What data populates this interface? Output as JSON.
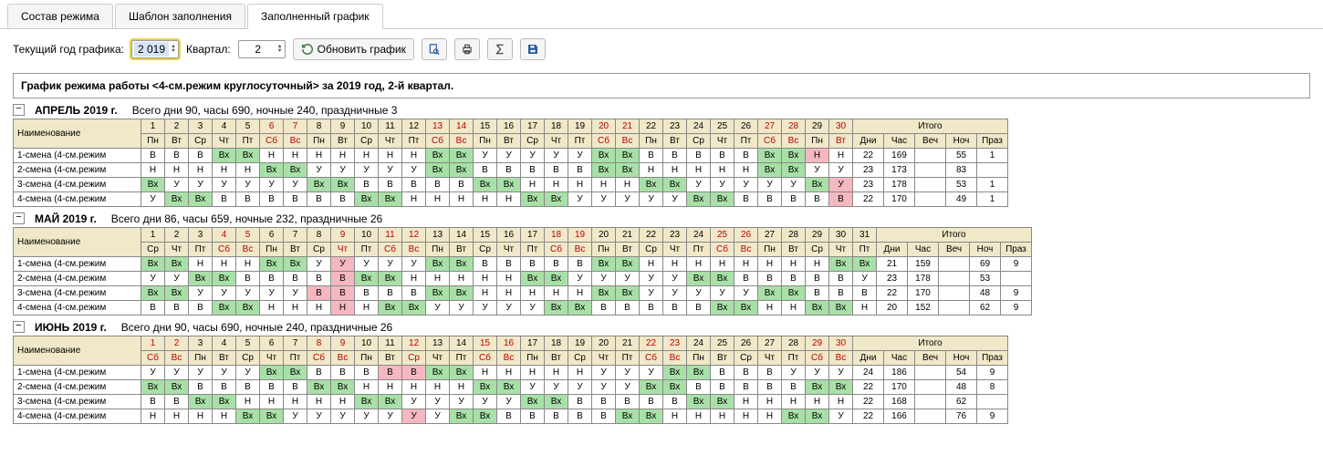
{
  "tabs": [
    "Состав режима",
    "Шаблон заполнения",
    "Заполненный график"
  ],
  "activeTab": 2,
  "toolbar": {
    "yearLabel": "Текущий год графика:",
    "yearValue": "2 019",
    "quarterLabel": "Квартал:",
    "quarterValue": "2",
    "refresh": "Обновить график"
  },
  "title": "График режима работы <4-см.режим круглосуточный> за 2019 год, 2-й квартал.",
  "rowHeader": "Наименование",
  "totalsHeader": "Итого",
  "totalsCols": [
    "Дни",
    "Час",
    "Веч",
    "Ноч",
    "Праз"
  ],
  "shifts": [
    "1-смена (4-см.режим",
    "2-смена (4-см.режим",
    "3-смена (4-см.режим",
    "4-смена (4-см.режим"
  ],
  "months": [
    {
      "name": "АПРЕЛЬ 2019 г.",
      "summary": "Всего дни 90, часы 690, ночные 240, праздничные 3",
      "nums": [
        "1",
        "2",
        "3",
        "4",
        "5",
        "6",
        "7",
        "8",
        "9",
        "10",
        "11",
        "12",
        "13",
        "14",
        "15",
        "16",
        "17",
        "18",
        "19",
        "20",
        "21",
        "22",
        "23",
        "24",
        "25",
        "26",
        "27",
        "28",
        "29",
        "30"
      ],
      "numsRed": [
        0,
        0,
        0,
        0,
        0,
        1,
        1,
        0,
        0,
        0,
        0,
        0,
        1,
        1,
        0,
        0,
        0,
        0,
        0,
        1,
        1,
        0,
        0,
        0,
        0,
        0,
        1,
        1,
        0,
        1
      ],
      "dows": [
        "Пн",
        "Вт",
        "Ср",
        "Чт",
        "Пт",
        "Сб",
        "Вс",
        "Пн",
        "Вт",
        "Ср",
        "Чт",
        "Пт",
        "Сб",
        "Вс",
        "Пн",
        "Вт",
        "Ср",
        "Чт",
        "Пт",
        "Сб",
        "Вс",
        "Пн",
        "Вт",
        "Ср",
        "Чт",
        "Пт",
        "Сб",
        "Вс",
        "Пн",
        "Вт"
      ],
      "rows": [
        {
          "cells": [
            "В",
            "В",
            "В",
            "Вх",
            "Вх",
            "Н",
            "Н",
            "Н",
            "Н",
            "Н",
            "Н",
            "Н",
            "Вх",
            "Вх",
            "У",
            "У",
            "У",
            "У",
            "У",
            "Вх",
            "Вх",
            "В",
            "В",
            "В",
            "В",
            "В",
            "Вх",
            "Вх",
            "Н",
            "Н"
          ],
          "colors": [
            "",
            "",
            "",
            "g",
            "g",
            "",
            "",
            "",
            "",
            "",
            "",
            "",
            "g",
            "g",
            "",
            "",
            "",
            "",
            "",
            "g",
            "g",
            "",
            "",
            "",
            "",
            "",
            "g",
            "g",
            "p",
            ""
          ],
          "totals": [
            "22",
            "169",
            "",
            "55",
            "1"
          ]
        },
        {
          "cells": [
            "Н",
            "Н",
            "Н",
            "Н",
            "Н",
            "Вх",
            "Вх",
            "У",
            "У",
            "У",
            "У",
            "У",
            "Вх",
            "Вх",
            "В",
            "В",
            "В",
            "В",
            "В",
            "Вх",
            "Вх",
            "Н",
            "Н",
            "Н",
            "Н",
            "Н",
            "Вх",
            "Вх",
            "У",
            "У"
          ],
          "colors": [
            "",
            "",
            "",
            "",
            "",
            "g",
            "g",
            "",
            "",
            "",
            "",
            "",
            "g",
            "g",
            "",
            "",
            "",
            "",
            "",
            "g",
            "g",
            "",
            "",
            "",
            "",
            "",
            "g",
            "g",
            "",
            ""
          ],
          "totals": [
            "23",
            "173",
            "",
            "83",
            ""
          ]
        },
        {
          "cells": [
            "Вх",
            "У",
            "У",
            "У",
            "У",
            "У",
            "У",
            "Вх",
            "Вх",
            "В",
            "В",
            "В",
            "В",
            "В",
            "Вх",
            "Вх",
            "Н",
            "Н",
            "Н",
            "Н",
            "Н",
            "Вх",
            "Вх",
            "У",
            "У",
            "У",
            "У",
            "У",
            "Вх",
            "У"
          ],
          "colors": [
            "g",
            "",
            "",
            "",
            "",
            "",
            "",
            "g",
            "g",
            "",
            "",
            "",
            "",
            "",
            "g",
            "g",
            "",
            "",
            "",
            "",
            "",
            "g",
            "g",
            "",
            "",
            "",
            "",
            "",
            "g",
            "p"
          ],
          "totals": [
            "23",
            "178",
            "",
            "53",
            "1"
          ]
        },
        {
          "cells": [
            "У",
            "Вх",
            "Вх",
            "В",
            "В",
            "В",
            "В",
            "В",
            "В",
            "Вх",
            "Вх",
            "Н",
            "Н",
            "Н",
            "Н",
            "Н",
            "Вх",
            "Вх",
            "У",
            "У",
            "У",
            "У",
            "У",
            "Вх",
            "Вх",
            "В",
            "В",
            "В",
            "В",
            "В"
          ],
          "colors": [
            "",
            "g",
            "g",
            "",
            "",
            "",
            "",
            "",
            "",
            "g",
            "g",
            "",
            "",
            "",
            "",
            "",
            "g",
            "g",
            "",
            "",
            "",
            "",
            "",
            "g",
            "g",
            "",
            "",
            "",
            "",
            "p"
          ],
          "totals": [
            "22",
            "170",
            "",
            "49",
            "1"
          ]
        }
      ]
    },
    {
      "name": "МАЙ 2019 г.",
      "summary": "Всего дни 86, часы 659, ночные 232, праздничные 26",
      "nums": [
        "1",
        "2",
        "3",
        "4",
        "5",
        "6",
        "7",
        "8",
        "9",
        "10",
        "11",
        "12",
        "13",
        "14",
        "15",
        "16",
        "17",
        "18",
        "19",
        "20",
        "21",
        "22",
        "23",
        "24",
        "25",
        "26",
        "27",
        "28",
        "29",
        "30",
        "31"
      ],
      "numsRed": [
        0,
        0,
        0,
        1,
        1,
        0,
        0,
        0,
        1,
        0,
        1,
        1,
        0,
        0,
        0,
        0,
        0,
        1,
        1,
        0,
        0,
        0,
        0,
        0,
        1,
        1,
        0,
        0,
        0,
        0,
        0
      ],
      "dows": [
        "Ср",
        "Чт",
        "Пт",
        "Сб",
        "Вс",
        "Пн",
        "Вт",
        "Ср",
        "Чт",
        "Пт",
        "Сб",
        "Вс",
        "Пн",
        "Вт",
        "Ср",
        "Чт",
        "Пт",
        "Сб",
        "Вс",
        "Пн",
        "Вт",
        "Ср",
        "Чт",
        "Пт",
        "Сб",
        "Вс",
        "Пн",
        "Вт",
        "Ср",
        "Чт",
        "Пт"
      ],
      "rows": [
        {
          "cells": [
            "Вх",
            "Вх",
            "Н",
            "Н",
            "Н",
            "Вх",
            "Вх",
            "У",
            "У",
            "У",
            "У",
            "У",
            "Вх",
            "Вх",
            "В",
            "В",
            "В",
            "В",
            "В",
            "Вх",
            "Вх",
            "Н",
            "Н",
            "Н",
            "Н",
            "Н",
            "Н",
            "Н",
            "Н",
            "Вх",
            "Вх"
          ],
          "colors": [
            "g",
            "g",
            "",
            "",
            "",
            "g",
            "g",
            "",
            "p",
            "",
            "",
            "",
            "g",
            "g",
            "",
            "",
            "",
            "",
            "",
            "g",
            "g",
            "",
            "",
            "",
            "",
            "",
            "",
            "",
            "",
            "g",
            "g"
          ],
          "totals": [
            "21",
            "159",
            "",
            "69",
            "9"
          ]
        },
        {
          "cells": [
            "У",
            "У",
            "Вх",
            "Вх",
            "В",
            "В",
            "В",
            "В",
            "В",
            "Вх",
            "Вх",
            "Н",
            "Н",
            "Н",
            "Н",
            "Н",
            "Вх",
            "Вх",
            "У",
            "У",
            "У",
            "У",
            "У",
            "Вх",
            "Вх",
            "В",
            "В",
            "В",
            "В",
            "В",
            "У"
          ],
          "colors": [
            "",
            "",
            "g",
            "g",
            "",
            "",
            "",
            "",
            "p",
            "g",
            "g",
            "",
            "",
            "",
            "",
            "",
            "g",
            "g",
            "",
            "",
            "",
            "",
            "",
            "g",
            "g",
            "",
            "",
            "",
            "",
            "",
            ""
          ],
          "totals": [
            "23",
            "178",
            "",
            "53",
            ""
          ]
        },
        {
          "cells": [
            "Вх",
            "Вх",
            "У",
            "У",
            "У",
            "У",
            "У",
            "В",
            "В",
            "В",
            "В",
            "В",
            "Вх",
            "Вх",
            "Н",
            "Н",
            "Н",
            "Н",
            "Н",
            "Вх",
            "Вх",
            "У",
            "У",
            "У",
            "У",
            "У",
            "Вх",
            "Вх",
            "В",
            "В",
            "В"
          ],
          "colors": [
            "g",
            "g",
            "",
            "",
            "",
            "",
            "",
            "p",
            "p",
            "",
            "",
            "",
            "g",
            "g",
            "",
            "",
            "",
            "",
            "",
            "g",
            "g",
            "",
            "",
            "",
            "",
            "",
            "g",
            "g",
            "",
            "",
            ""
          ],
          "totals": [
            "22",
            "170",
            "",
            "48",
            "9"
          ]
        },
        {
          "cells": [
            "В",
            "В",
            "В",
            "Вх",
            "Вх",
            "Н",
            "Н",
            "Н",
            "Н",
            "Н",
            "Вх",
            "Вх",
            "У",
            "У",
            "У",
            "У",
            "У",
            "Вх",
            "Вх",
            "В",
            "В",
            "В",
            "В",
            "В",
            "Вх",
            "Вх",
            "Н",
            "Н",
            "Вх",
            "Вх",
            "Н"
          ],
          "colors": [
            "",
            "",
            "",
            "g",
            "g",
            "",
            "",
            "",
            "p",
            "",
            "g",
            "g",
            "",
            "",
            "",
            "",
            "",
            "g",
            "g",
            "",
            "",
            "",
            "",
            "",
            "g",
            "g",
            "",
            "",
            "g",
            "g",
            ""
          ],
          "totals": [
            "20",
            "152",
            "",
            "62",
            "9"
          ]
        }
      ]
    },
    {
      "name": "ИЮНЬ 2019 г.",
      "summary": "Всего дни 90, часы 690, ночные 240, праздничные 26",
      "nums": [
        "1",
        "2",
        "3",
        "4",
        "5",
        "6",
        "7",
        "8",
        "9",
        "10",
        "11",
        "12",
        "13",
        "14",
        "15",
        "16",
        "17",
        "18",
        "19",
        "20",
        "21",
        "22",
        "23",
        "24",
        "25",
        "26",
        "27",
        "28",
        "29",
        "30"
      ],
      "numsRed": [
        1,
        1,
        0,
        0,
        0,
        0,
        0,
        1,
        1,
        0,
        0,
        1,
        0,
        0,
        1,
        1,
        0,
        0,
        0,
        0,
        0,
        1,
        1,
        0,
        0,
        0,
        0,
        0,
        1,
        1
      ],
      "dows": [
        "Сб",
        "Вс",
        "Пн",
        "Вт",
        "Ср",
        "Чт",
        "Пт",
        "Сб",
        "Вс",
        "Пн",
        "Вт",
        "Ср",
        "Чт",
        "Пт",
        "Сб",
        "Вс",
        "Пн",
        "Вт",
        "Ср",
        "Чт",
        "Пт",
        "Сб",
        "Вс",
        "Пн",
        "Вт",
        "Ср",
        "Чт",
        "Пт",
        "Сб",
        "Вс"
      ],
      "rows": [
        {
          "cells": [
            "У",
            "У",
            "У",
            "У",
            "У",
            "Вх",
            "Вх",
            "В",
            "В",
            "В",
            "В",
            "В",
            "Вх",
            "Вх",
            "Н",
            "Н",
            "Н",
            "Н",
            "Н",
            "У",
            "У",
            "У",
            "Вх",
            "Вх",
            "В",
            "В",
            "В",
            "У",
            "У",
            "У"
          ],
          "colors": [
            "",
            "",
            "",
            "",
            "",
            "g",
            "g",
            "",
            "",
            "",
            "p",
            "p",
            "g",
            "g",
            "",
            "",
            "",
            "",
            "",
            "",
            "",
            "",
            "g",
            "g",
            "",
            "",
            "",
            "",
            "",
            ""
          ],
          "totals": [
            "24",
            "186",
            "",
            "54",
            "9"
          ]
        },
        {
          "cells": [
            "Вх",
            "Вх",
            "В",
            "В",
            "В",
            "В",
            "В",
            "Вх",
            "Вх",
            "Н",
            "Н",
            "Н",
            "Н",
            "Н",
            "Вх",
            "Вх",
            "У",
            "У",
            "У",
            "У",
            "У",
            "Вх",
            "Вх",
            "В",
            "В",
            "В",
            "В",
            "В",
            "Вх",
            "Вх"
          ],
          "colors": [
            "g",
            "g",
            "",
            "",
            "",
            "",
            "",
            "g",
            "g",
            "",
            "",
            "",
            "",
            "",
            "g",
            "g",
            "",
            "",
            "",
            "",
            "",
            "g",
            "g",
            "",
            "",
            "",
            "",
            "",
            "g",
            "g"
          ],
          "totals": [
            "22",
            "170",
            "",
            "48",
            "8"
          ]
        },
        {
          "cells": [
            "В",
            "В",
            "Вх",
            "Вх",
            "Н",
            "Н",
            "Н",
            "Н",
            "Н",
            "Вх",
            "Вх",
            "У",
            "У",
            "У",
            "У",
            "У",
            "Вх",
            "Вх",
            "В",
            "В",
            "В",
            "В",
            "В",
            "Вх",
            "Вх",
            "Н",
            "Н",
            "Н",
            "Н",
            "Н"
          ],
          "colors": [
            "",
            "",
            "g",
            "g",
            "",
            "",
            "",
            "",
            "",
            "g",
            "g",
            "",
            "",
            "",
            "",
            "",
            "g",
            "g",
            "",
            "",
            "",
            "",
            "",
            "g",
            "g",
            "",
            "",
            "",
            "",
            ""
          ],
          "totals": [
            "22",
            "168",
            "",
            "62",
            ""
          ]
        },
        {
          "cells": [
            "Н",
            "Н",
            "Н",
            "Н",
            "Вх",
            "Вх",
            "У",
            "У",
            "У",
            "У",
            "У",
            "У",
            "У",
            "Вх",
            "Вх",
            "В",
            "В",
            "В",
            "В",
            "В",
            "Вх",
            "Вх",
            "Н",
            "Н",
            "Н",
            "Н",
            "Н",
            "Вх",
            "Вх",
            "У"
          ],
          "colors": [
            "",
            "",
            "",
            "",
            "g",
            "g",
            "",
            "",
            "",
            "",
            "",
            "p",
            "",
            "g",
            "g",
            "",
            "",
            "",
            "",
            "",
            "g",
            "g",
            "",
            "",
            "",
            "",
            "",
            "g",
            "g",
            ""
          ],
          "totals": [
            "22",
            "166",
            "",
            "76",
            "9"
          ]
        }
      ]
    }
  ]
}
